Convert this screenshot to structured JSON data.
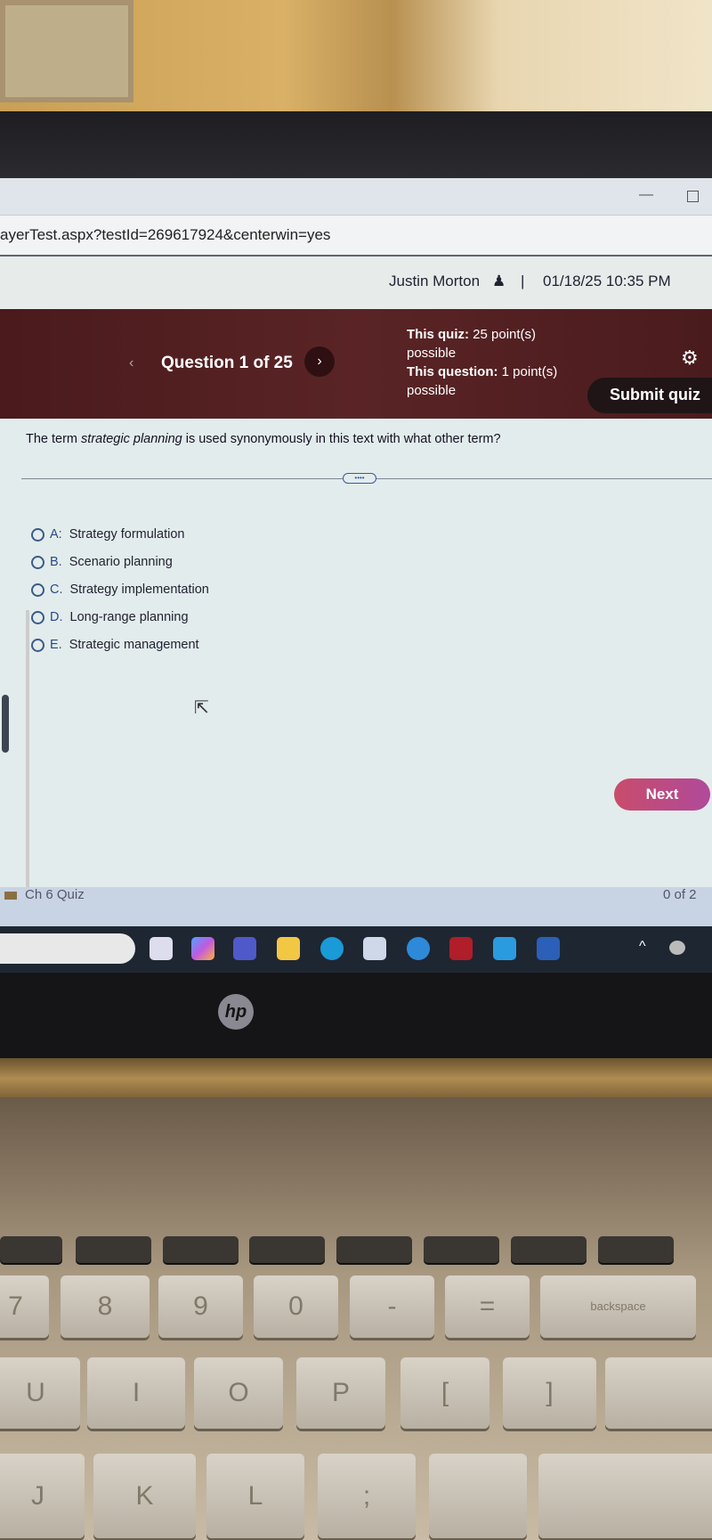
{
  "browser": {
    "url": "ayerTest.aspx?testId=269617924&centerwin=yes",
    "minimize_icon": "minimize-icon",
    "maximize_icon": "maximize-icon"
  },
  "header": {
    "user_name": "Justin Morton",
    "user_icon": "user-icon",
    "separator": "|",
    "datetime": "01/18/25 10:35 PM"
  },
  "banner": {
    "prev_label": "‹",
    "question_counter": "Question 1 of 25",
    "next_label": "›",
    "quiz_points_label": "This quiz:",
    "quiz_points_value": "25 point(s) possible",
    "question_points_label": "This question:",
    "question_points_value": "1 point(s) possible",
    "settings_icon": "gear-icon",
    "submit_label": "Submit quiz",
    "color": "#4f1f21"
  },
  "question": {
    "text_before": "The term ",
    "text_emphasis": "strategic planning",
    "text_after": " is used synonymously in this text with what other term?",
    "divider_handle": "••••",
    "options": [
      {
        "letter": "A:",
        "text": "Strategy formulation"
      },
      {
        "letter": "B.",
        "text": "Scenario planning"
      },
      {
        "letter": "C.",
        "text": "Strategy implementation"
      },
      {
        "letter": "D.",
        "text": "Long-range planning"
      },
      {
        "letter": "E.",
        "text": "Strategic management"
      }
    ],
    "selected": null
  },
  "footer": {
    "next_label": "Next",
    "next_color": "#c8507a",
    "quiz_name": "Ch 6 Quiz",
    "progress": "0 of 2"
  },
  "taskbar": {
    "icons": [
      "task-view-icon",
      "copilot-icon",
      "teams-icon",
      "file-explorer-icon",
      "edge-icon",
      "store-icon",
      "help-icon",
      "mcafee-icon",
      "app-icon",
      "word-icon"
    ],
    "tray_chevron": "^"
  },
  "laptop": {
    "brand": "hp",
    "keys_row1": [
      "7",
      "8",
      "9",
      "0",
      "-",
      "=",
      "backspace"
    ],
    "keys_row2": [
      "U",
      "I",
      "O",
      "P",
      "[",
      "]"
    ],
    "keys_row3": [
      "J",
      "K",
      "L",
      ";"
    ]
  }
}
